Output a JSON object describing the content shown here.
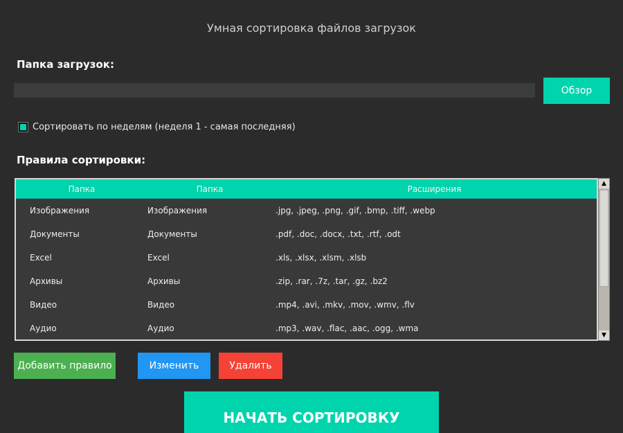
{
  "title": "Умная сортировка файлов загрузок",
  "folder": {
    "label": "Папка загрузок:",
    "value": "",
    "browse": "Обзор"
  },
  "checkbox": {
    "label": "Сортировать по неделям (неделя 1 - самая последняя)",
    "checked": true
  },
  "rules": {
    "label": "Правила сортировки:",
    "headers": [
      "Папка",
      "Папка",
      "Расширения"
    ],
    "rows": [
      [
        "Изображения",
        "Изображения",
        ".jpg, .jpeg, .png, .gif, .bmp, .tiff, .webp"
      ],
      [
        "Документы",
        "Документы",
        ".pdf, .doc, .docx, .txt, .rtf, .odt"
      ],
      [
        "Excel",
        "Excel",
        ".xls, .xlsx, .xlsm, .xlsb"
      ],
      [
        "Архивы",
        "Архивы",
        ".zip, .rar, .7z, .tar, .gz, .bz2"
      ],
      [
        "Видео",
        "Видео",
        ".mp4, .avi, .mkv, .mov, .wmv, .flv"
      ],
      [
        "Аудио",
        "Аудио",
        ".mp3, .wav, .flac, .aac, .ogg, .wma"
      ]
    ]
  },
  "buttons": {
    "add": "Добавить правило",
    "edit": "Изменить",
    "delete": "Удалить",
    "start": "НАЧАТЬ СОРТИРОВКУ"
  },
  "colors": {
    "accent": "#00d4ad",
    "add": "#4caf50",
    "edit": "#2196f3",
    "delete": "#f44336"
  }
}
